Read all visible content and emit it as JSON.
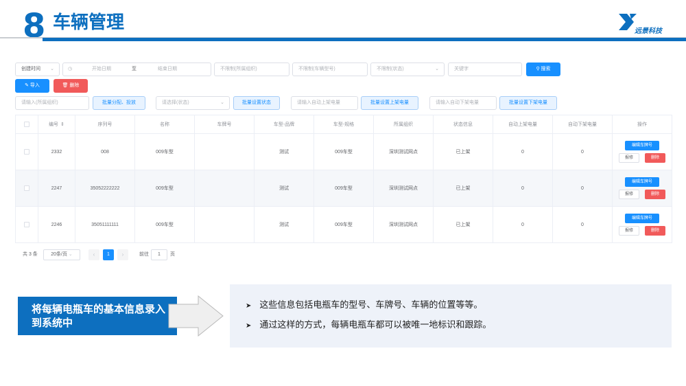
{
  "header": {
    "number": "8",
    "title": "车辆管理",
    "logo_text": "远景科技"
  },
  "filters": {
    "date_type": "创建时间",
    "start_placeholder": "开始日期",
    "range_sep": "至",
    "end_placeholder": "结束日期",
    "org_placeholder": "不限制(所属组织)",
    "model_placeholder": "不限制(车辆型号)",
    "status_placeholder": "不限制(状态)",
    "keyword_placeholder": "关键字",
    "search_label": "搜索"
  },
  "actions": {
    "import_label": "导入",
    "delete_label": "删除"
  },
  "batch": {
    "org_input_placeholder": "请输入(所属组织)",
    "assign_label": "批量分配、投放",
    "status_select_placeholder": "请选择(状态)",
    "set_status_label": "批量设置状态",
    "auto_up_placeholder": "请输入自动上架电量",
    "set_up_label": "批量设置上架电量",
    "auto_down_placeholder": "请输入自动下架电量",
    "set_down_label": "批量设置下架电量"
  },
  "table": {
    "headers": [
      "编号",
      "序列号",
      "名称",
      "车牌号",
      "车型-品牌",
      "车型-规格",
      "所属组织",
      "状态信息",
      "自动上架电量",
      "自动下架电量",
      "操作"
    ],
    "rows": [
      {
        "id": "2332",
        "serial": "008",
        "name": "009车型",
        "plate": "",
        "brand": "测试",
        "spec": "009车型",
        "org": "深圳测试网点",
        "status": "已上架",
        "auto_up": "0",
        "auto_down": "0"
      },
      {
        "id": "2247",
        "serial": "35052222222",
        "name": "009车型",
        "plate": "",
        "brand": "测试",
        "spec": "009车型",
        "org": "深圳测试网点",
        "status": "已上架",
        "auto_up": "0",
        "auto_down": "0"
      },
      {
        "id": "2246",
        "serial": "35051111111",
        "name": "009车型",
        "plate": "",
        "brand": "测试",
        "spec": "009车型",
        "org": "深圳测试网点",
        "status": "已上架",
        "auto_up": "0",
        "auto_down": "0"
      }
    ],
    "op_edit_plate": "编辑车牌号",
    "op_report": "报修",
    "op_delete": "删除"
  },
  "pagination": {
    "total": "共 3 条",
    "page_size": "20条/页",
    "current": "1",
    "goto_label": "前往",
    "goto_value": "1",
    "page_unit": "页"
  },
  "callout": {
    "label": "将每辆电瓶车的基本信息录入到系统中"
  },
  "bullets": [
    "这些信息包括电瓶车的型号、车牌号、车辆的位置等等。",
    "通过这样的方式，每辆电瓶车都可以被唯一地标识和跟踪。"
  ],
  "colors": {
    "brand": "#0d6fbf",
    "primary": "#1890ff",
    "danger": "#f15a5a"
  },
  "icons": {
    "calendar": "clock-icon",
    "search": "search-icon",
    "import": "edit-icon",
    "delete": "trash-icon",
    "sort": "sort-icon"
  }
}
